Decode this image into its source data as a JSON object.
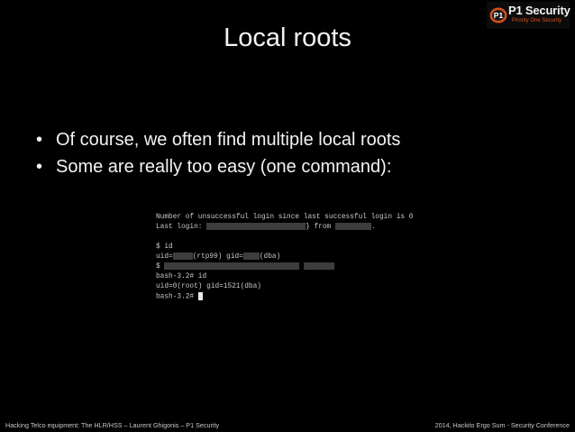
{
  "logo": {
    "badge": "P1",
    "name": "P1 Security",
    "tagline": "Priority One Security",
    "colors": {
      "accent": "#d9501c",
      "text": "#f2f2f2"
    }
  },
  "slide": {
    "title": "Local roots",
    "bullets": [
      "Of course, we often find multiple local roots",
      "Some are really too easy (one command):"
    ]
  },
  "terminal": {
    "lines": [
      {
        "text": "Number of unsuccessful login since last successful login is 0"
      },
      {
        "pre": "Last login:",
        "mid": "} from",
        "post": "."
      },
      {
        "text": "$ id"
      },
      {
        "pre": "uid=",
        "mid": "(rtp99) gid=",
        "post": "(dba)"
      },
      {
        "pre": "$"
      },
      {
        "text": "bash-3.2# id"
      },
      {
        "text": "uid=0(root) gid=1521(dba)"
      },
      {
        "text": "bash-3.2#"
      }
    ]
  },
  "footer": {
    "left": "Hacking Telco equipment: The HLR/HSS – Laurent Ghigonis – P1 Security",
    "right": "2014, Hackito Ergo Sum - Security Conference"
  }
}
